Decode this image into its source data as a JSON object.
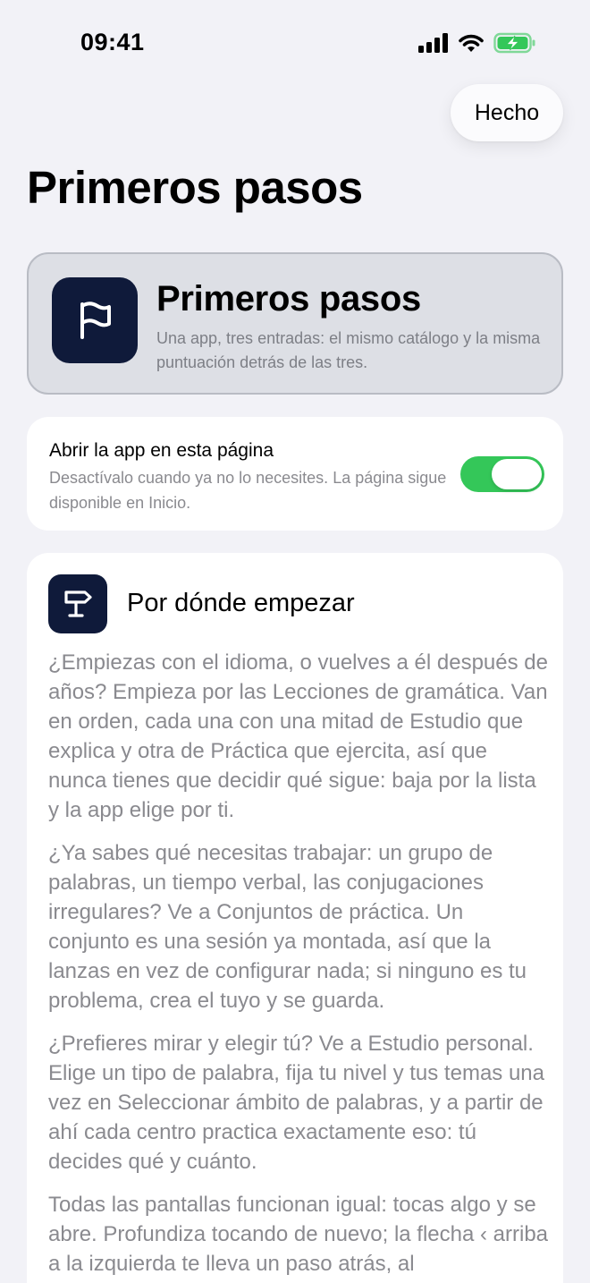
{
  "status_bar": {
    "time": "09:41"
  },
  "nav": {
    "done_label": "Hecho"
  },
  "page": {
    "title": "Primeros pasos"
  },
  "header_card": {
    "icon": "flag-icon",
    "title": "Primeros pasos",
    "subtitle": "Una app, tres entradas: el mismo catálogo y la misma puntuación detrás de las tres."
  },
  "toggle_card": {
    "title": "Abrir la app en esta página",
    "description": "Desactívalo cuando ya no lo necesites. La página sigue disponible en Inicio.",
    "enabled": true
  },
  "guide_card": {
    "icon": "signpost-icon",
    "title": "Por dónde empezar",
    "paragraphs": [
      "¿Empiezas con el idioma, o vuelves a él después de años? Empieza por las Lecciones de gramática. Van en orden, cada una con una mitad de Estudio que explica y otra de Práctica que ejercita, así que nunca tienes que decidir qué sigue: baja por la lista y la app elige por ti.",
      "¿Ya sabes qué necesitas trabajar: un grupo de palabras, un tiempo verbal, las conjugaciones irregulares? Ve a Conjuntos de práctica. Un conjunto es una sesión ya montada, así que la lanzas en vez de configurar nada; si ninguno es tu problema, crea el tuyo y se guarda.",
      "¿Prefieres mirar y elegir tú? Ve a Estudio personal. Elige un tipo de palabra, fija tu nivel y tus temas una vez en Seleccionar ámbito de palabras, y a partir de ahí cada centro practica exactamente eso: tú decides qué y cuánto.",
      "Todas las pantallas funcionan igual: tocas algo y se abre. Profundiza tocando de nuevo; la flecha ‹ arriba a la izquierda te lleva un paso atrás, al"
    ]
  },
  "colors": {
    "background": "#f2f2f7",
    "card": "#ffffff",
    "icon_tile": "#0f1a3a",
    "toggle_on": "#34c759",
    "secondary_text": "#8a8a8f",
    "battery_green": "#34c759"
  }
}
